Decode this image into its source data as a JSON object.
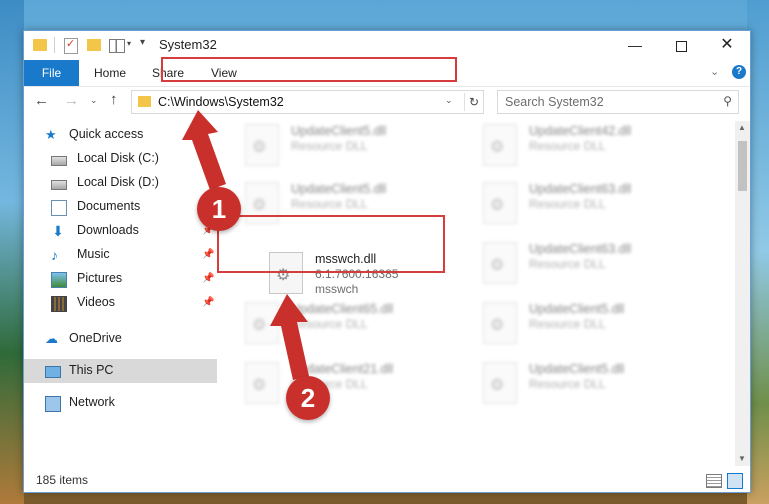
{
  "window": {
    "title": "System32",
    "min_glyph": "—",
    "close_glyph": "✕"
  },
  "ribbon": {
    "file": "File",
    "home": "Home",
    "share": "Share",
    "view": "View",
    "collapse_glyph": "⌄",
    "help_glyph": "?"
  },
  "nav": {
    "back_glyph": "←",
    "forward_glyph": "→",
    "recent_glyph": "⌄",
    "up_glyph": "↑",
    "address": "C:\\Windows\\System32",
    "address_dd_glyph": "⌄",
    "refresh_glyph": "↻",
    "search_placeholder": "Search System32",
    "search_glyph": "⚲"
  },
  "sidebar": {
    "items": [
      {
        "label": "Quick access",
        "icon": "star-icon",
        "pinned": false
      },
      {
        "label": "Local Disk (C:)",
        "icon": "drive-icon",
        "pinned": false
      },
      {
        "label": "Local Disk (D:)",
        "icon": "drive-icon",
        "pinned": false
      },
      {
        "label": "Documents",
        "icon": "documents-icon",
        "pinned": true
      },
      {
        "label": "Downloads",
        "icon": "download-icon",
        "pinned": true
      },
      {
        "label": "Music",
        "icon": "music-icon",
        "pinned": true
      },
      {
        "label": "Pictures",
        "icon": "pictures-icon",
        "pinned": true
      },
      {
        "label": "Videos",
        "icon": "videos-icon",
        "pinned": true
      },
      {
        "label": "OneDrive",
        "icon": "onedrive-icon",
        "pinned": false
      },
      {
        "label": "This PC",
        "icon": "pc-icon",
        "pinned": false
      },
      {
        "label": "Network",
        "icon": "network-icon",
        "pinned": false
      }
    ],
    "pin_glyph": "📌"
  },
  "files": [
    {
      "name": "UpdateClient5.dll",
      "line1": "Resource DLL",
      "line2": ""
    },
    {
      "name": "UpdateClient42.dll",
      "line1": "Resource DLL",
      "line2": ""
    },
    {
      "name": "UpdateClient5.dll",
      "line1": "Resource DLL",
      "line2": ""
    },
    {
      "name": "UpdateClient63.dll",
      "line1": "Resource DLL",
      "line2": ""
    },
    {
      "name": "msswch.dll",
      "line1": "6.1.7600.16385",
      "line2": "msswch"
    },
    {
      "name": "UpdateClient63.dll",
      "line1": "Resource DLL",
      "line2": ""
    },
    {
      "name": "UpdateClient65.dll",
      "line1": "Resource DLL",
      "line2": ""
    },
    {
      "name": "UpdateClient5.dll",
      "line1": "Resource DLL",
      "line2": ""
    },
    {
      "name": "UpdateClient21.dll",
      "line1": "Resource DLL",
      "line2": ""
    },
    {
      "name": "UpdateClient5.dll",
      "line1": "Resource DLL",
      "line2": ""
    }
  ],
  "file_gear_glyph": "⚙",
  "status": {
    "count": "185 items"
  },
  "annotations": {
    "step1": "1",
    "step2": "2",
    "color": "#c9302c"
  }
}
